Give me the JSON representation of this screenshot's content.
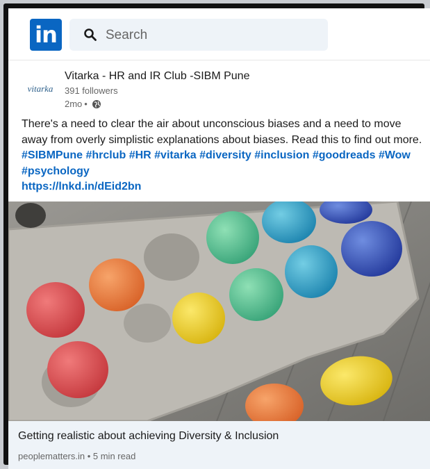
{
  "header": {
    "logo_text": "in",
    "search_placeholder": "Search"
  },
  "post": {
    "author": "Vitarka - HR and IR Club -SIBM Pune",
    "avatar_text": "vitarka",
    "followers": "391 followers",
    "age": "2mo",
    "separator": "•",
    "visibility_icon": "globe-icon",
    "text": "There's a need to clear the air about unconscious biases and a need to move away from overly simplistic explanations about biases. Read this to find out more.",
    "hashtags": "#SIBMPune #hrclub #HR #vitarka #diversity #inclusion #goodreads #Wow #psychology",
    "link": "https://lnkd.in/dEid2bn"
  },
  "article": {
    "title": "Getting realistic about achieving Diversity & Inclusion",
    "source": "peoplematters.in • 5 min read"
  },
  "colors": {
    "brand": "#0a66c2",
    "search_bg": "#eef3f8",
    "article_bg": "#eef3f8"
  }
}
